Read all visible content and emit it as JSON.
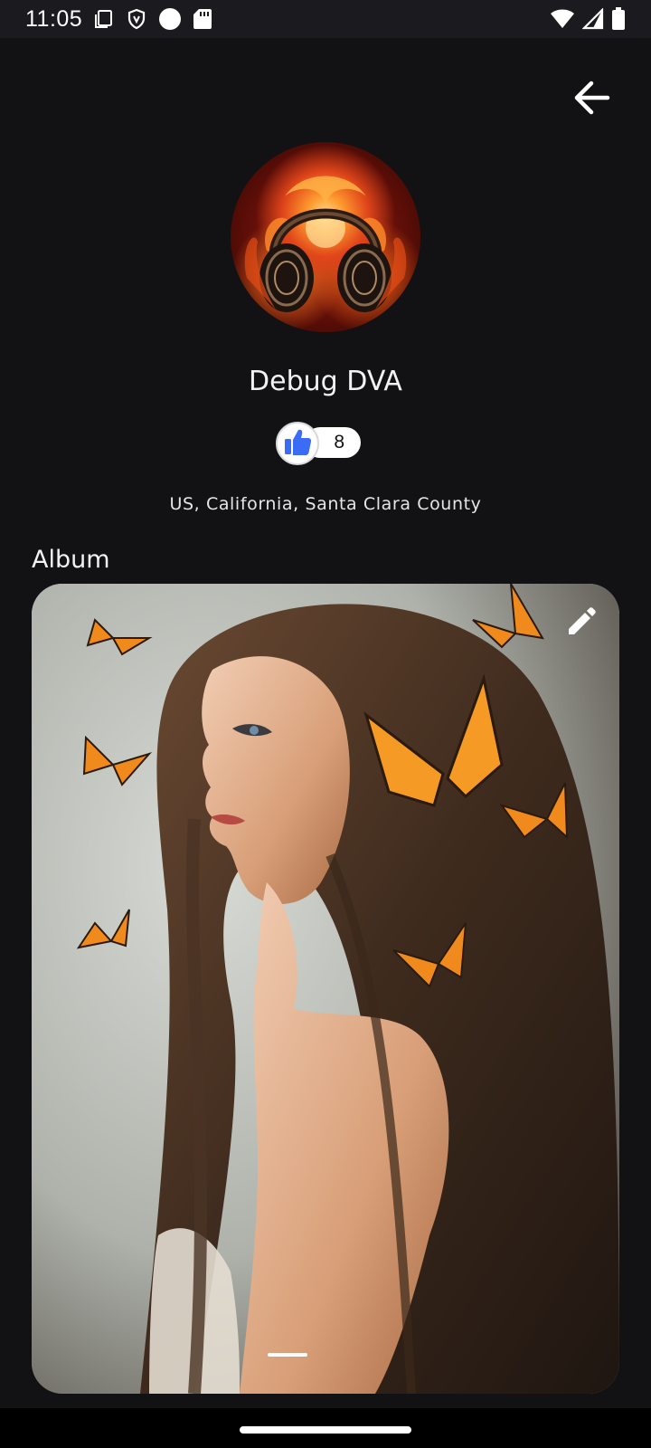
{
  "status_bar": {
    "time": "11:05",
    "icons_left": [
      "screen-icon",
      "shield-icon",
      "circle-icon",
      "sd-card-icon"
    ],
    "icons_right": [
      "wifi-icon",
      "cell-signal-icon",
      "battery-icon"
    ]
  },
  "header": {
    "back_icon": "arrow-back-icon"
  },
  "profile": {
    "avatar": "headphones-fire-avatar",
    "name": "Debug DVA",
    "like_icon": "thumbs-up-icon",
    "like_count": "8",
    "location": "US, California, Santa Clara County"
  },
  "album": {
    "title": "Album",
    "edit_icon": "pencil-icon",
    "image": "woman-with-butterflies-photo",
    "page_indicator_count": 1
  },
  "colors": {
    "background": "#121214",
    "status_bar": "#1b1b1f",
    "text_primary": "#ffffff",
    "like_accent": "#3b6cf5"
  }
}
